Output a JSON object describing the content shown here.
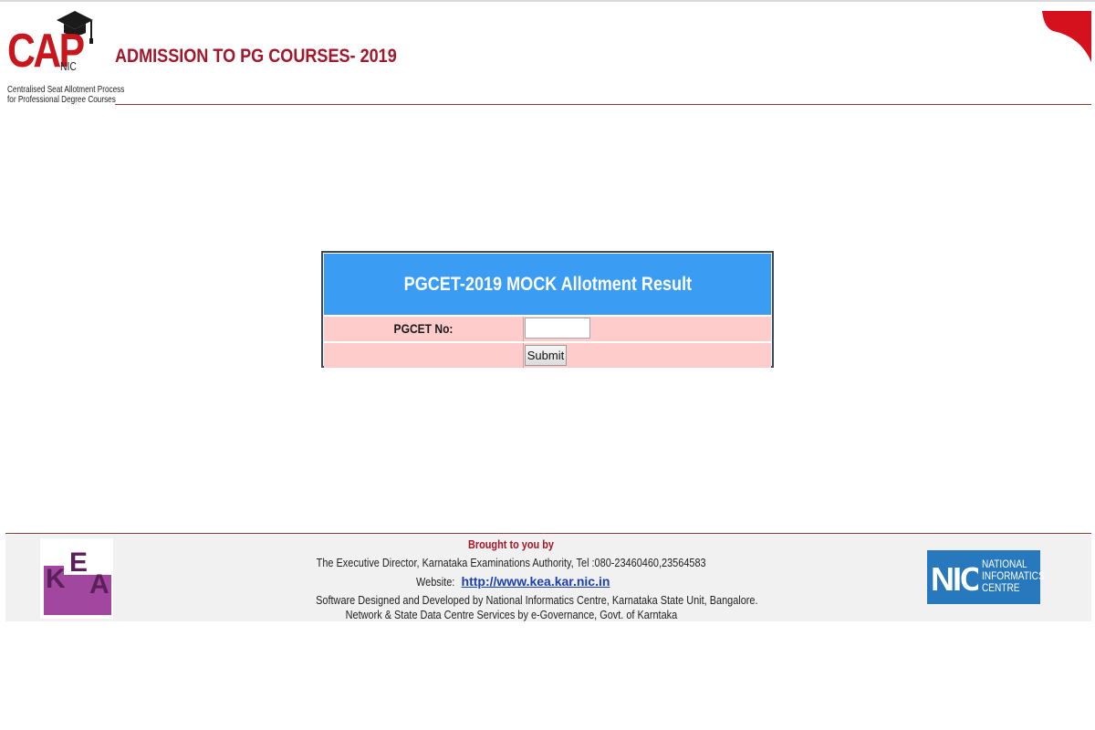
{
  "header": {
    "logo": {
      "letters": "CAP",
      "suffix": "NIC",
      "subtitle_line1": "Centralised Seat Allotment Process",
      "subtitle_line2": "for Professional Degree Courses"
    },
    "title": "ADMISSION TO PG COURSES- 2019"
  },
  "form": {
    "title": "PGCET-2019 MOCK Allotment Result",
    "pgcet_label": "PGCET No:",
    "pgcet_value": "",
    "submit_label": "Submit"
  },
  "footer": {
    "brought": "Brought to you by",
    "director": "The Executive Director, Karnataka Examinations Authority, Tel :080-23460460,23564583",
    "website_label": "Website:",
    "website_link": "http://www.kea.kar.nic.in",
    "designed": "Software Designed and Developed by National Informatics Centre, Karnataka State Unit, Bangalore.",
    "network": "Network & State Data Centre Services by e-Governance, Govt. of Karntaka",
    "kea_logo_text": "KEA",
    "nic_logo": {
      "mark": "NIC",
      "line1": "NATIONAL",
      "line2": "INFORMATICS",
      "line3": "CENTRE"
    }
  },
  "colors": {
    "brand_red": "#a3172a",
    "panel_header_blue": "#3a9cf3",
    "row_pink": "#ffcccc",
    "kea_purple": "#a1479f",
    "nic_blue": "#2878be",
    "link_blue": "#1a3fb5"
  }
}
